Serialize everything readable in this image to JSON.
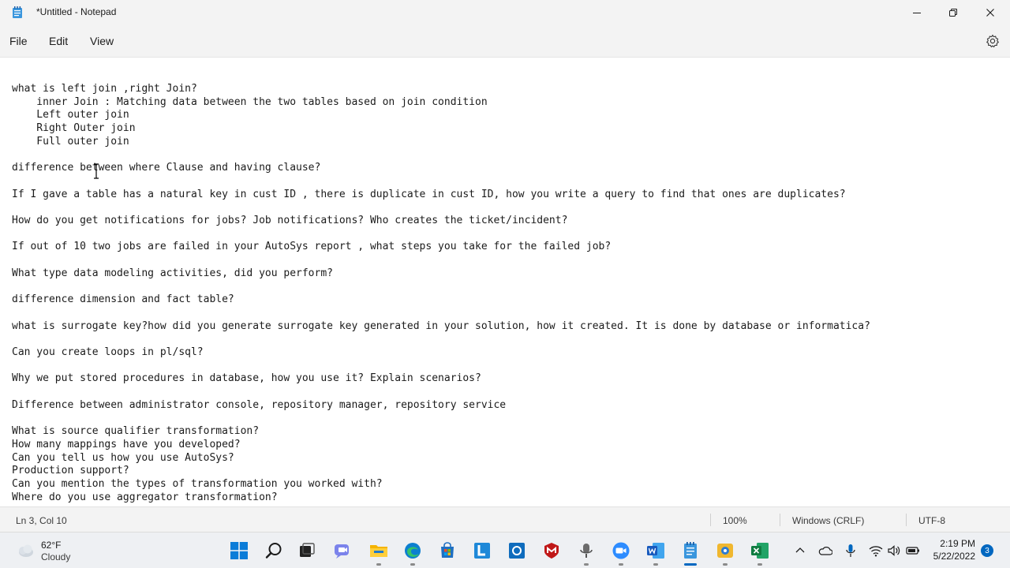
{
  "window": {
    "title": "*Untitled - Notepad"
  },
  "menu": {
    "file": "File",
    "edit": "Edit",
    "view": "View"
  },
  "editor": {
    "content": "what is left join ,right Join?\n    inner Join : Matching data between the two tables based on join condition\n    Left outer join\n    Right Outer join\n    Full outer join\n\ndifference between where Clause and having clause?\n\nIf I gave a table has a natural key in cust ID , there is duplicate in cust ID, how you write a query to find that ones are duplicates?\n\nHow do you get notifications for jobs? Job notifications? Who creates the ticket/incident?\n\nIf out of 10 two jobs are failed in your AutoSys report , what steps you take for the failed job?\n\nWhat type data modeling activities, did you perform?\n\ndifference dimension and fact table?\n\nwhat is surrogate key?how did you generate surrogate key generated in your solution, how it created. It is done by database or informatica?\n\nCan you create loops in pl/sql?\n\nWhy we put stored procedures in database, how you use it? Explain scenarios?\n\nDifference between administrator console, repository manager, repository service\n\nWhat is source qualifier transformation?\nHow many mappings have you developed?\nCan you tell us how you use AutoSys?\nProduction support?\nCan you mention the types of transformation you worked with?\nWhere do you use aggregator transformation?"
  },
  "status": {
    "position": "Ln 3, Col 10",
    "zoom": "100%",
    "line_ending": "Windows (CRLF)",
    "encoding": "UTF-8"
  },
  "taskbar": {
    "weather_temp": "62°F",
    "weather_condition": "Cloudy",
    "apps": [
      "windows-start-icon",
      "search-icon",
      "file-explorer-icon",
      "teams-chat-icon",
      "folder-icon",
      "edge-icon",
      "store-icon",
      "lync-icon",
      "outlook-icon",
      "mcafee-icon",
      "recorder-icon",
      "zoom-icon",
      "word-icon",
      "notepad-icon",
      "snip-icon",
      "excel-icon"
    ],
    "time": "2:19 PM",
    "date": "5/22/2022",
    "notification_count": "3"
  },
  "colors": {
    "accent": "#0067c0",
    "background": "#f3f3f3",
    "editor_bg": "#ffffff"
  }
}
